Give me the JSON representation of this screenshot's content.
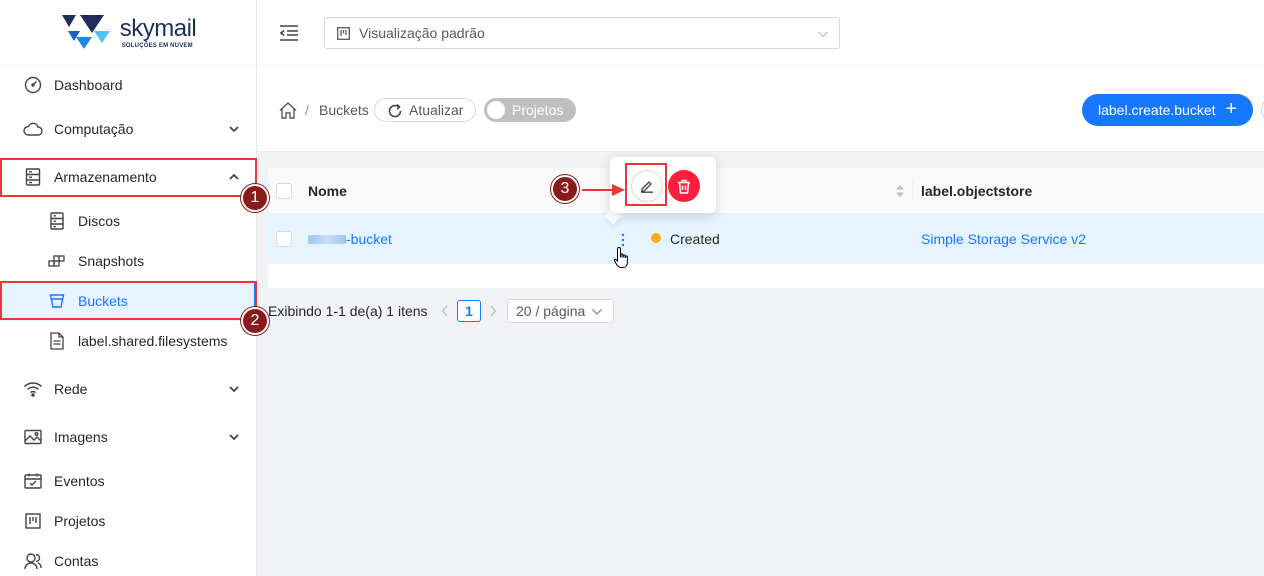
{
  "brand": {
    "name": "skymail",
    "tagline": "SOLUÇÕES EM NUVEM"
  },
  "sidebar": {
    "items": [
      {
        "label": "Dashboard",
        "icon": "dashboard-icon",
        "expandable": false
      },
      {
        "label": "Computação",
        "icon": "cloud-icon",
        "expandable": true
      },
      {
        "label": "Armazenamento",
        "icon": "storage-icon",
        "expandable": true,
        "expanded": true
      },
      {
        "label": "Discos",
        "icon": "disk-icon",
        "sub": true
      },
      {
        "label": "Snapshots",
        "icon": "snapshot-icon",
        "sub": true
      },
      {
        "label": "Buckets",
        "icon": "bucket-icon",
        "sub": true,
        "active": true
      },
      {
        "label": "label.shared.filesystems",
        "icon": "file-icon",
        "sub": true
      },
      {
        "label": "Rede",
        "icon": "wifi-icon",
        "expandable": true
      },
      {
        "label": "Imagens",
        "icon": "image-icon",
        "expandable": true
      },
      {
        "label": "Eventos",
        "icon": "calendar-icon",
        "expandable": false
      },
      {
        "label": "Projetos",
        "icon": "project-icon",
        "expandable": false
      },
      {
        "label": "Contas",
        "icon": "users-icon",
        "expandable": false
      }
    ]
  },
  "header": {
    "view_selector": "Visualização padrão"
  },
  "page": {
    "breadcrumb_sep": "/",
    "breadcrumb": "Buckets",
    "refresh_label": "Atualizar",
    "projects_toggle": "Projetos",
    "create_label": "label.create.bucket",
    "create_plus": "+"
  },
  "table": {
    "columns": [
      "Nome",
      "label.objectstore"
    ],
    "rows": [
      {
        "name_suffix": "-bucket",
        "status": "Created",
        "objectstore": "Simple Storage Service v2"
      }
    ]
  },
  "pagination": {
    "summary": "Exibindo 1-1 de(a) 1 itens",
    "current": "1",
    "page_size": "20 / página"
  },
  "annotations": {
    "one": "1",
    "two": "2",
    "three": "3"
  },
  "colors": {
    "primary": "#1677ff",
    "danger": "#ff1f3d",
    "warning": "#faad14",
    "annotation": "#8b1a1a",
    "highlight": "#e53935"
  }
}
